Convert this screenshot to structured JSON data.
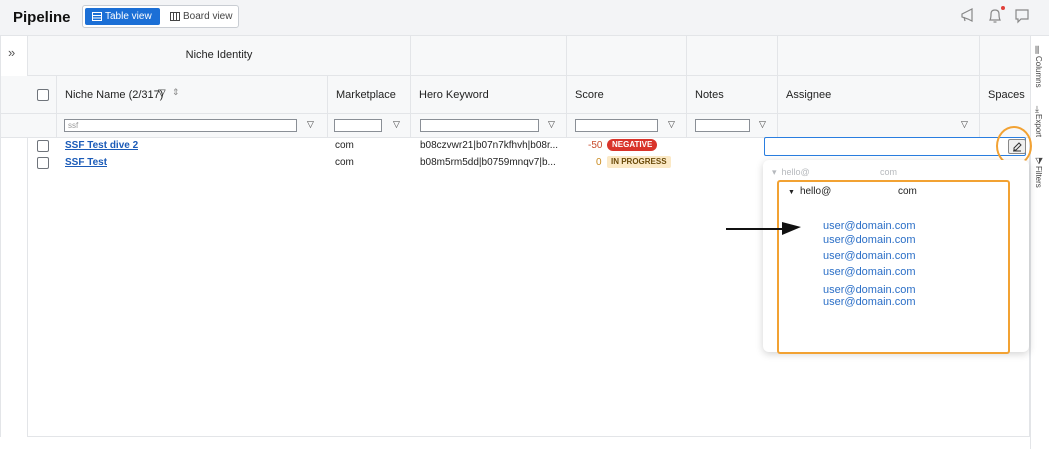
{
  "header": {
    "title": "Pipeline",
    "views": [
      {
        "label": "Table view",
        "active": true
      },
      {
        "label": "Board view",
        "active": false
      }
    ],
    "accent_color": "#1b6fd6"
  },
  "grid": {
    "group_header": "Niche Identity",
    "columns": [
      {
        "label": "Niche Name (2/317)"
      },
      {
        "label": "Marketplace"
      },
      {
        "label": "Hero Keyword"
      },
      {
        "label": "Score"
      },
      {
        "label": "Notes"
      },
      {
        "label": "Assignee"
      },
      {
        "label": "Spaces"
      }
    ],
    "filter_value": "ssf",
    "rows": [
      {
        "name": "SSF Test dive 2",
        "marketplace": "com",
        "hero_keyword": "b08czvwr21|b07n7kfhvh|b08r...",
        "score": "-50",
        "status": "NEGATIVE"
      },
      {
        "name": "SSF Test",
        "marketplace": "com",
        "hero_keyword": "b08m5rm5dd|b0759mnqv7|b...",
        "score": "0",
        "status": "IN PROGRESS"
      }
    ]
  },
  "side_panel": {
    "columns_label": "Columns",
    "export_label": "Export",
    "filters_label": "Filters"
  },
  "assignee_dropdown": {
    "faded_group": {
      "prefix": "hello@",
      "suffix": "com"
    },
    "group": {
      "prefix": "hello@",
      "suffix": "com"
    },
    "emails": [
      "user@domain.com",
      "user@domain.com",
      "user@domain.com",
      "user@domain.com",
      "user@domain.com",
      "user@domain.com"
    ]
  },
  "highlight_color": "#f2a233"
}
